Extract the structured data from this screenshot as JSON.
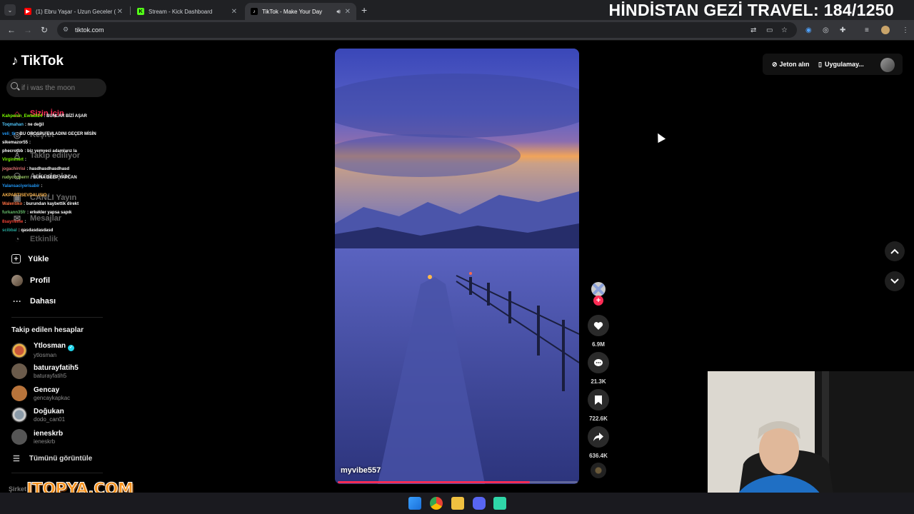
{
  "browser": {
    "tabs": [
      {
        "title": "(1) Ebru Yaşar - Uzun Geceler (",
        "favicon_color": "#ff0000"
      },
      {
        "title": "Stream - Kick Dashboard",
        "favicon_color": "#53fc18"
      },
      {
        "title": "TikTok - Make Your Day",
        "favicon_color": "#000000"
      }
    ],
    "url": "tiktok.com",
    "new_tab_label": "+"
  },
  "stream_overlay": {
    "title": "HİNDİSTAN GEZİ TRAVEL: 184/1250",
    "watermark": "ITOPYA.COM"
  },
  "tiktok": {
    "logo": "TikTok",
    "search_placeholder": "if i was the moon",
    "nav": [
      {
        "label": "Sizin İçin",
        "icon": "home-icon"
      },
      {
        "label": "Keşfet",
        "icon": "compass-icon"
      },
      {
        "label": "Takip ediliyor",
        "icon": "following-icon"
      },
      {
        "label": "Arkadaşlar",
        "icon": "friends-icon"
      },
      {
        "label": "CANLI Yayın",
        "icon": "live-icon"
      },
      {
        "label": "Mesajlar",
        "icon": "messages-icon"
      },
      {
        "label": "Etkinlik",
        "icon": "activity-icon"
      },
      {
        "label": "Yükle",
        "icon": "upload-icon"
      },
      {
        "label": "Profil",
        "icon": "profile-icon"
      },
      {
        "label": "Dahası",
        "icon": "more-icon"
      }
    ],
    "following_header": "Takip edilen hesaplar",
    "following": [
      {
        "name": "Ytlosman",
        "handle": "ytlosman",
        "verified": true,
        "color": "#c9573a"
      },
      {
        "name": "baturayfatih5",
        "handle": "baturayfatih5",
        "verified": false,
        "color": "#6b5b4b"
      },
      {
        "name": "Gencay",
        "handle": "gencaykapkac",
        "verified": false,
        "color": "#b8743b"
      },
      {
        "name": "Doğukan",
        "handle": "dodo_can01",
        "verified": false,
        "color": "#8a9aa8"
      },
      {
        "name": "ieneskrb",
        "handle": "ieneskrb",
        "verified": false,
        "color": "#555555"
      }
    ],
    "see_all": "Tümünü görüntüle",
    "footer_partial": "Şirket",
    "top_right": {
      "coins_label": "Jeton alın",
      "app_label": "Uygulamay..."
    },
    "video": {
      "author": "myvibe557",
      "progress": 0.8,
      "likes": "6.9M",
      "comments": "21.3K",
      "saves": "722.6K",
      "shares": "636.4K"
    }
  },
  "chat": [
    {
      "user": "Kahpenin_Ewladi24",
      "msg": "BUNLAR BİZİ AŞAR",
      "color": "#7cfc00"
    },
    {
      "user": "Toqmahan",
      "msg": "ne değil",
      "color": "#4fc3f7"
    },
    {
      "user": "veli_tk",
      "msg": "BU OROSPU EVLADINI GEÇER MİSİN",
      "color": "#2196f3"
    },
    {
      "user": "sikemazor55",
      "msg": "",
      "color": "#ffffff"
    },
    {
      "user": "phecrotbb",
      "msg": "biz yemyeci adamlarız la",
      "color": "#ffffff"
    },
    {
      "user": "Virginmert",
      "msg": "",
      "color": "#7cfc00"
    },
    {
      "user": "jogachirrisi",
      "msg": "hasdhasdhasdhasd",
      "color": "#e57373"
    },
    {
      "user": "rudycooperrr",
      "msg": "BUNA DEEP YAPCAN",
      "color": "#9ccc65"
    },
    {
      "user": "Yalansaciyerisabir",
      "msg": "",
      "color": "#2196f3"
    },
    {
      "user": "AKPARTISEVDALISIO",
      "msg": "",
      "color": "#ffb74d"
    },
    {
      "user": "Walentiko",
      "msg": "burundan kaybettik direkt",
      "color": "#ff7043"
    },
    {
      "user": "furkann35fr",
      "msg": "erkekler yapsa sapık",
      "color": "#66bb6a"
    },
    {
      "user": "8sayrieme",
      "msg": "",
      "color": "#f44336"
    },
    {
      "user": "scibbal",
      "msg": "qasdasdasdasd",
      "color": "#26a69a"
    }
  ],
  "colors": {
    "accent": "#fe2c55",
    "chrome_dark": "#202124",
    "chrome_toolbar": "#35363a"
  }
}
